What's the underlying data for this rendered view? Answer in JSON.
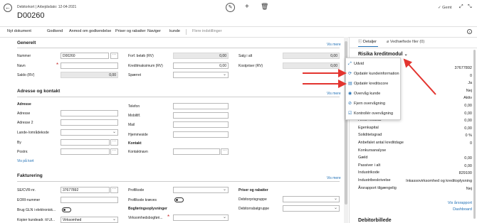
{
  "header": {
    "breadcrumb": "Debitorkort | Arbejdsdato: 12-04-2021",
    "title": "D00260",
    "saved": "Gemt"
  },
  "actions": [
    "Nyt dokument",
    "Godkend",
    "Anmod om godkendelse",
    "Priser og rabatter",
    "Naviger",
    "kunde",
    "Flere indstillinger"
  ],
  "general": {
    "title": "Generelt",
    "show_more": "Vis mere",
    "labels": [
      "Nummer",
      "Navn",
      "Saldo (RV)",
      "Forf. beløb (RV)",
      "Kreditmaksimum (RV)",
      "Spærret",
      "Salg i alt",
      "Kostpriser (RV)"
    ],
    "number": "D00260",
    "saldo": "0,00",
    "forf": "0,00",
    "kredit": "0,00",
    "salg": "0,00",
    "kost": "0,00"
  },
  "address": {
    "title": "Adresse og kontakt",
    "show_more": "Vis mere",
    "sub": "Adresse",
    "labels": [
      "Adresse",
      "Adresse 2",
      "Lande-/områdekode",
      "By",
      "Postnr."
    ],
    "map_link": "Vis på kort",
    "right_labels": [
      "Telefon",
      "Mobiltlf.",
      "Mail",
      "Hjemmeside"
    ],
    "contact_sub": "Kontakt",
    "contact_label": "Kontaktnavn"
  },
  "billing": {
    "title": "Fakturering",
    "show_more": "Vis mere",
    "labels": [
      "SE/CVR-nr.",
      "EORI-nummer",
      "Brug GLN i elektronisk...",
      "Kopier kundeadr. til Ul..."
    ],
    "cvr": "37677892",
    "kopier_value": "Virksomhed",
    "mid_labels": [
      "Profilkode",
      "Profilkode kræves"
    ],
    "booking_sub": "Bogføringsoplysninger",
    "booking_label": "Virksomhedsbogføri...",
    "price_sub": "Priser og rabatter",
    "price_labels": [
      "Debitorprisgruppe",
      "Debitorrabatgruppe"
    ]
  },
  "panel": {
    "tab_details": "Detaljer",
    "tab_files": "Vedhæftede filer (0)",
    "risk_title": "Risika kreditmodul",
    "rows": [
      [
        "",
        "37677892"
      ],
      [
        "",
        "0"
      ],
      [
        "",
        "Ja"
      ],
      [
        "",
        "Nej"
      ],
      [
        "",
        "Aktiv"
      ],
      [
        "",
        "0,00"
      ],
      [
        "",
        "0,00"
      ],
      [
        "Årets resultat",
        "0,00"
      ],
      [
        "Egenkapital",
        "0,00"
      ],
      [
        "Soliditetsgrad",
        "0 %"
      ],
      [
        "Anbefalet antal kreditdage",
        "0"
      ],
      [
        "Konkursanalyse",
        ""
      ],
      [
        "Gæld",
        "0,00"
      ],
      [
        "Passiver i alt",
        "0,00"
      ],
      [
        "Industrikode",
        "829100"
      ],
      [
        "Industribeskrivelse",
        "Inkassovirksomhed og kreditoplysning"
      ],
      [
        "Årsrapport tilgængelig",
        "Nej"
      ]
    ],
    "links": [
      "Vis årsrapport",
      "Dashboard"
    ],
    "bottom_title": "Debitorbillede"
  },
  "menu": {
    "items": [
      "Udvid",
      "Opdatér kundeinformation",
      "Opdatér kreditscore",
      "Overvåg kunde",
      "Fjern overvågning",
      "Kontrollér overvågning"
    ]
  },
  "colors": {
    "accent": "#1f6fb5",
    "arrow": "#e3342f",
    "required": "#c62828"
  }
}
